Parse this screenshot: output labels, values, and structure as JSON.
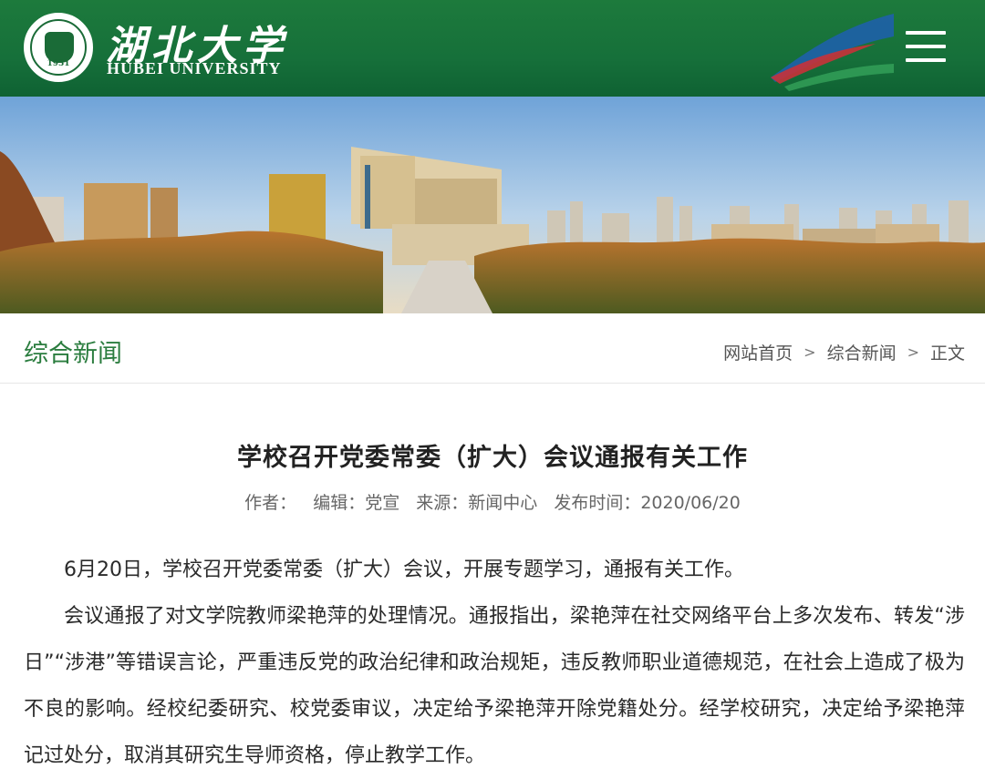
{
  "header": {
    "logo_cn": "湖北大学",
    "logo_en": "HUBEI UNIVERSITY",
    "logo_year": "1931",
    "brand_color": "#16703a"
  },
  "section": {
    "title": "综合新闻"
  },
  "breadcrumb": {
    "items": [
      "网站首页",
      "综合新闻",
      "正文"
    ],
    "separator": ">"
  },
  "article": {
    "title": "学校召开党委常委（扩大）会议通报有关工作",
    "meta": {
      "author": "作者：",
      "editor": "编辑：党宣",
      "source": "来源：新闻中心",
      "published": "发布时间：2020/06/20"
    },
    "paragraphs": [
      "6月20日，学校召开党委常委（扩大）会议，开展专题学习，通报有关工作。",
      "会议通报了对文学院教师梁艳萍的处理情况。通报指出，梁艳萍在社交网络平台上多次发布、转发“涉日”“涉港”等错误言论，严重违反党的政治纪律和政治规矩，违反教师职业道德规范，在社会上造成了极为不良的影响。经校纪委研究、校党委审议，决定给予梁艳萍开除党籍处分。经学校研究，决定给予梁艳萍记过处分，取消其研究生导师资格，停止教学工作。"
    ]
  }
}
